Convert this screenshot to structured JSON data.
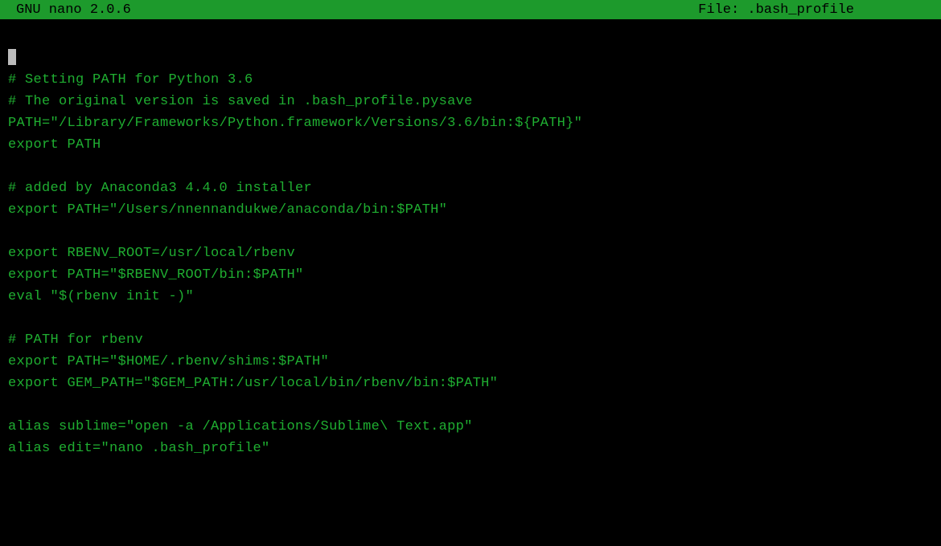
{
  "titlebar": {
    "app": "GNU nano 2.0.6",
    "file_label": "File: .bash_profile"
  },
  "lines": [
    "",
    "# Setting PATH for Python 3.6",
    "# The original version is saved in .bash_profile.pysave",
    "PATH=\"/Library/Frameworks/Python.framework/Versions/3.6/bin:${PATH}\"",
    "export PATH",
    "",
    "# added by Anaconda3 4.4.0 installer",
    "export PATH=\"/Users/nnennandukwe/anaconda/bin:$PATH\"",
    "",
    "export RBENV_ROOT=/usr/local/rbenv",
    "export PATH=\"$RBENV_ROOT/bin:$PATH\"",
    "eval \"$(rbenv init -)\"",
    "",
    "# PATH for rbenv",
    "export PATH=\"$HOME/.rbenv/shims:$PATH\"",
    "export GEM_PATH=\"$GEM_PATH:/usr/local/bin/rbenv/bin:$PATH\"",
    "",
    "alias sublime=\"open -a /Applications/Sublime\\ Text.app\"",
    "alias edit=\"nano .bash_profile\""
  ]
}
